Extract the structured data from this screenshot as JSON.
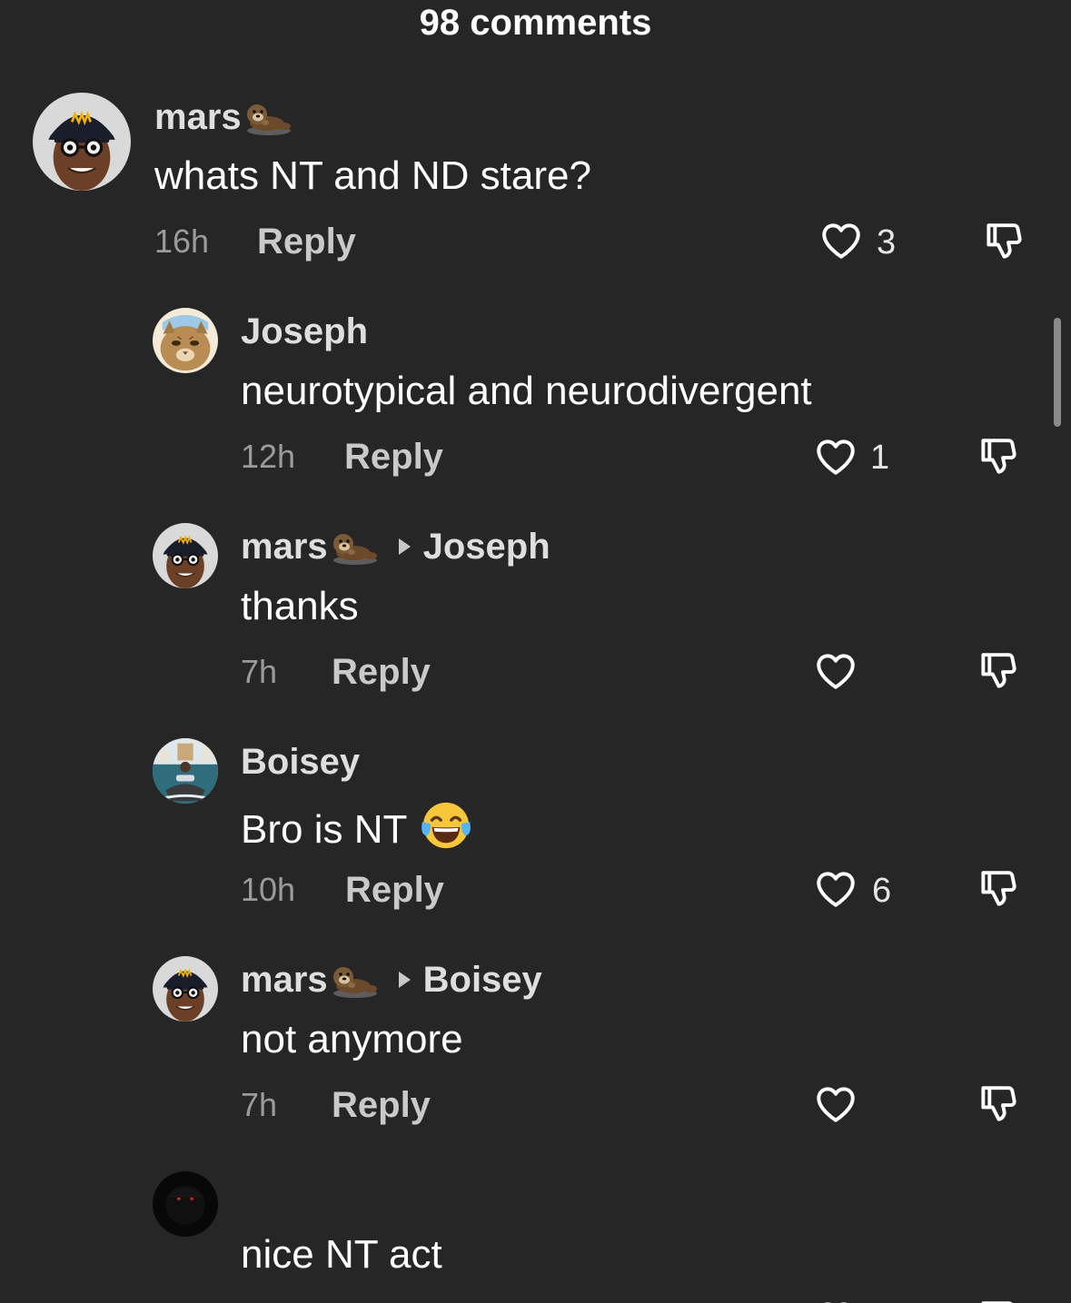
{
  "header": {
    "title": "98 comments"
  },
  "comments": [
    {
      "username": "mars",
      "reply_to": "",
      "text": "whats NT and ND stare?",
      "time": "16h",
      "reply_label": "Reply",
      "likes": "3"
    },
    {
      "username": "Joseph",
      "reply_to": "",
      "text": "neurotypical and neurodivergent",
      "time": "12h",
      "reply_label": "Reply",
      "likes": "1"
    },
    {
      "username": "mars",
      "reply_to": "Joseph",
      "text": "thanks",
      "time": "7h",
      "reply_label": "Reply",
      "likes": ""
    },
    {
      "username": "Boisey",
      "reply_to": "",
      "text": "Bro is NT",
      "time": "10h",
      "reply_label": "Reply",
      "likes": "6"
    },
    {
      "username": "mars",
      "reply_to": "Boisey",
      "text": "not anymore",
      "time": "7h",
      "reply_label": "Reply",
      "likes": ""
    },
    {
      "username": "",
      "reply_to": "",
      "text": "nice NT act",
      "time": "",
      "reply_label": "",
      "likes": ""
    }
  ],
  "icons": {
    "like": "heart-outline-icon",
    "dislike": "thumbs-down-icon",
    "username_badge": "otter-emoji",
    "reply_indicator": "triangle-right-icon",
    "text_emoji": "tears-of-joy-emoji"
  },
  "colors": {
    "background": "#262626",
    "text_primary": "#ffffff",
    "text_secondary": "#9b9b9b",
    "username": "#dedede"
  }
}
